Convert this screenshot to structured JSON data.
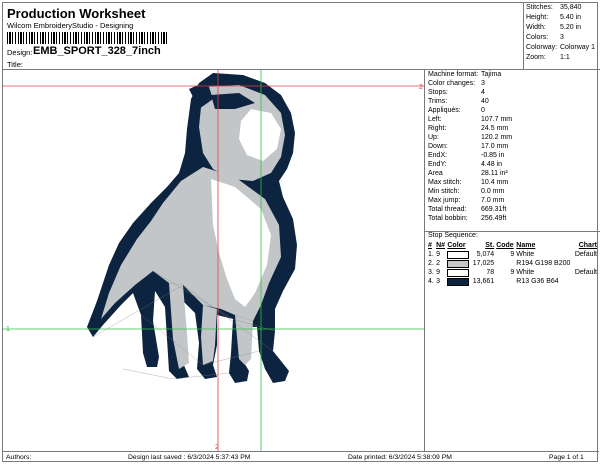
{
  "header": {
    "title": "Production Worksheet",
    "subtitle": "Wilcom EmbroideryStudio - Designing",
    "design_label": "Design:",
    "design_name": "EMB_SPORT_328_7inch",
    "title_label": "Title:"
  },
  "top_stats": [
    {
      "label": "Stitches:",
      "value": "35,840"
    },
    {
      "label": "Height:",
      "value": "5.40 in"
    },
    {
      "label": "Width:",
      "value": "5.20 in"
    },
    {
      "label": "Colors:",
      "value": "3"
    },
    {
      "label": "Colorway:",
      "value": "Colorway 1"
    },
    {
      "label": "Zoom:",
      "value": "1:1"
    }
  ],
  "info": [
    {
      "label": "Machine format:",
      "value": "Tajima"
    },
    {
      "label": "Color changes:",
      "value": "3"
    },
    {
      "label": "Stops:",
      "value": "4"
    },
    {
      "label": "Trims:",
      "value": "40"
    },
    {
      "label": "Appliqués:",
      "value": "0"
    },
    {
      "label": "Left:",
      "value": "107.7 mm"
    },
    {
      "label": "Right:",
      "value": "24.5 mm"
    },
    {
      "label": "Up:",
      "value": "120.2 mm"
    },
    {
      "label": "Down:",
      "value": "17.0 mm"
    },
    {
      "label": "EndX:",
      "value": "-0.85 in"
    },
    {
      "label": "EndY:",
      "value": "4.48 in"
    },
    {
      "label": "Area",
      "value": "28.11 in²"
    },
    {
      "label": "Max stitch:",
      "value": "10.4 mm"
    },
    {
      "label": "Min stitch:",
      "value": "0.0 mm"
    },
    {
      "label": "Max jump:",
      "value": "7.0 mm"
    },
    {
      "label": "Total thread:",
      "value": "669.31ft"
    },
    {
      "label": "Total bobbin:",
      "value": "256.49ft"
    }
  ],
  "stop_sequence": {
    "title": "Stop Sequence:",
    "headers": [
      "#",
      "N#",
      "Color",
      "St.",
      "Code",
      "Name",
      "Chart"
    ],
    "rows": [
      {
        "num": "1.",
        "n": "9",
        "color": "#ffffff",
        "st": "5,074",
        "code": "9",
        "name": "White",
        "chart": "Default"
      },
      {
        "num": "2.",
        "n": "2",
        "color": "#c2c6c8",
        "st": "17,025",
        "code": "",
        "name": "R194 G198 B200",
        "chart": ""
      },
      {
        "num": "3.",
        "n": "9",
        "color": "#ffffff",
        "st": "78",
        "code": "9",
        "name": "White",
        "chart": "Default"
      },
      {
        "num": "4.",
        "n": "3",
        "color": "#0d2440",
        "st": "13,661",
        "code": "",
        "name": "R13 G36 B64",
        "chart": ""
      }
    ]
  },
  "canvas": {
    "guide_labels": {
      "top_right": "2",
      "left_mid": "1",
      "bottom": "2"
    },
    "colors": {
      "navy": "#0d2440",
      "gray": "#c2c6c8",
      "white": "#ffffff",
      "guide_red": "#e04040",
      "guide_green": "#30c040"
    }
  },
  "footer": {
    "authors": "Authors:",
    "last_saved": "Design last saved : 6/3/2024 5:37:43 PM",
    "printed": "Date printed: 6/3/2024 5:38:09 PM",
    "page": "Page 1 of 1"
  }
}
